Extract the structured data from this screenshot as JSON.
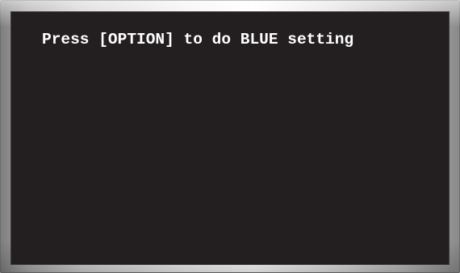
{
  "screen": {
    "message": "Press [OPTION] to do BLUE setting"
  },
  "colors": {
    "screen_background": "#231f20",
    "text": "#ffffff",
    "bezel": "#c8c8c8"
  }
}
